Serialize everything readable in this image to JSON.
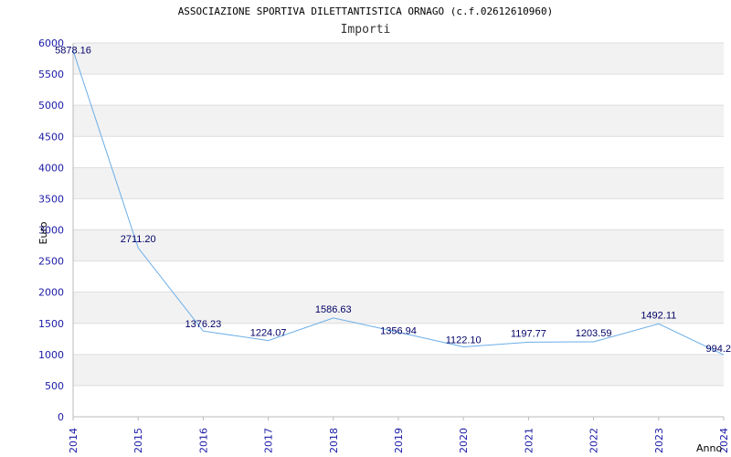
{
  "chart_data": {
    "type": "line",
    "title": "ASSOCIAZIONE SPORTIVA DILETTANTISTICA ORNAGO (c.f.02612610960)",
    "subtitle": "Importi",
    "xlabel": "Anno",
    "ylabel": "Euro",
    "ylim": [
      0,
      6000
    ],
    "y_ticks": [
      0,
      500,
      1000,
      1500,
      2000,
      2500,
      3000,
      3500,
      4000,
      4500,
      5000,
      5500,
      6000
    ],
    "categories": [
      "2014",
      "2015",
      "2016",
      "2017",
      "2018",
      "2019",
      "2020",
      "2021",
      "2022",
      "2023",
      "2024"
    ],
    "series": [
      {
        "values": [
          5878.16,
          2711.2,
          1376.23,
          1224.07,
          1586.63,
          1356.94,
          1122.1,
          1197.77,
          1203.59,
          1492.11,
          994.2
        ],
        "labels": [
          "5878.16",
          "2711.20",
          "1376.23",
          "1224.07",
          "1586.63",
          "1356.94",
          "1122.10",
          "1197.77",
          "1203.59",
          "1492.11",
          "994.2"
        ]
      }
    ],
    "grid": true,
    "colors": {
      "line": "#6aaee8",
      "band_alt": "#f2f2f2",
      "grid": "#dddddd",
      "tick_text": "#1a1aa6",
      "label_text": "#000066"
    }
  }
}
